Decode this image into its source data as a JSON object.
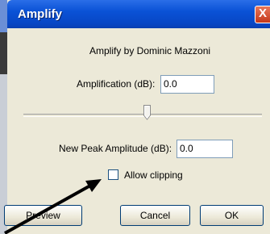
{
  "window": {
    "title": "Amplify",
    "close_glyph": "X"
  },
  "dialog": {
    "credit": "Amplify by Dominic Mazzoni",
    "amplification_label": "Amplification (dB):",
    "amplification_value": "0.0",
    "new_peak_label": "New Peak Amplitude (dB):",
    "new_peak_value": "0.0",
    "allow_clipping_label": "Allow clipping",
    "allow_clipping_checked": false,
    "slider_level_fraction": 0.55
  },
  "buttons": {
    "preview": "Preview",
    "cancel": "Cancel",
    "ok": "OK"
  },
  "icons": {
    "close": "close-icon",
    "arrow": "annotation-arrow-icon"
  },
  "colors": {
    "titlebar": "#0a52d6",
    "dialog_bg": "#ece9d8",
    "close": "#c4381a"
  }
}
